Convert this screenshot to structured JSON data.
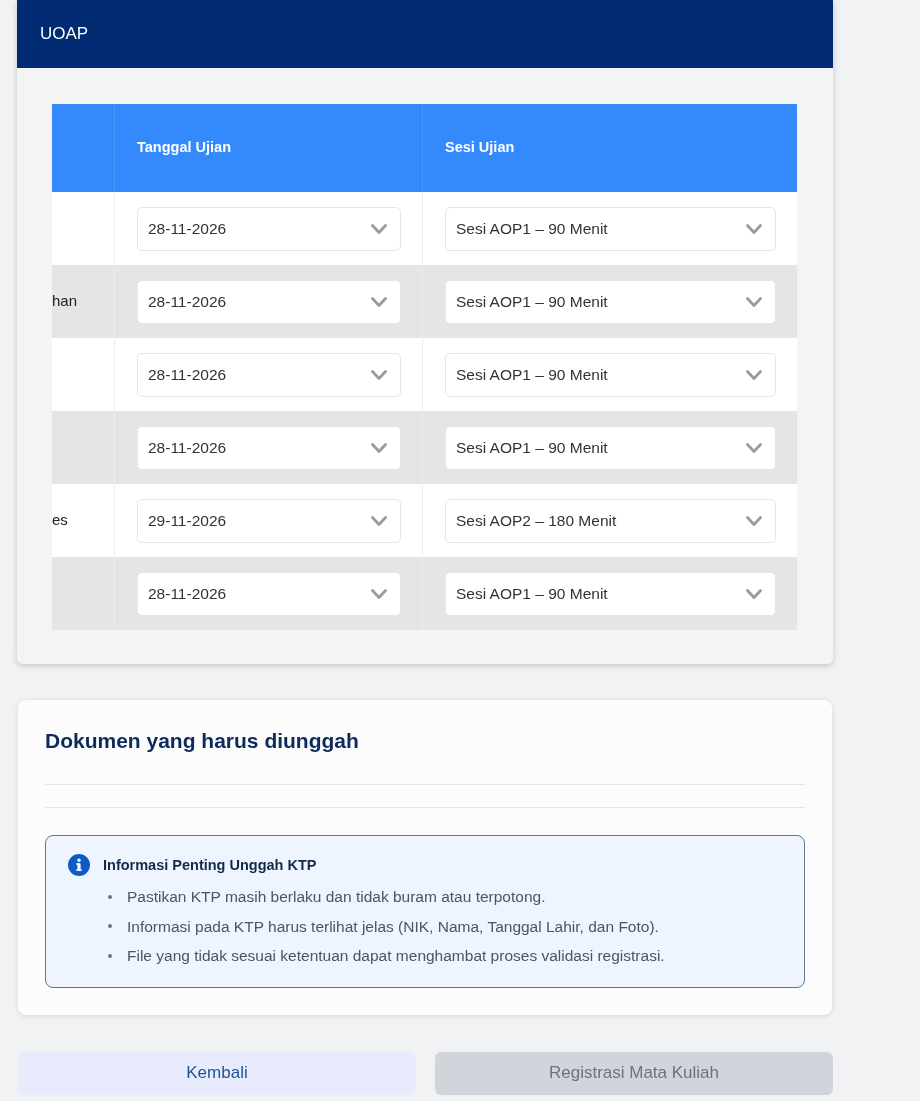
{
  "header": {
    "title": "UOAP"
  },
  "table": {
    "columns": [
      "Tanggal Ujian",
      "Sesi Ujian"
    ],
    "rows": [
      {
        "exam_date": "28-11-2026",
        "exam_session": "Sesi AOP1 – 90 Menit"
      },
      {
        "column_1": "han",
        "exam_date": "28-11-2026",
        "exam_session": "Sesi AOP1 – 90 Menit"
      },
      {
        "exam_date": "28-11-2026",
        "exam_session": "Sesi AOP1 – 90 Menit"
      },
      {
        "exam_date": "28-11-2026",
        "exam_session": "Sesi AOP1 – 90 Menit"
      },
      {
        "column_1": "es",
        "exam_date": "29-11-2026",
        "exam_session": "Sesi AOP2 – 180 Menit"
      },
      {
        "exam_date": "28-11-2026",
        "exam_session": "Sesi AOP1 – 90 Menit"
      }
    ]
  },
  "documents": {
    "title": "Dokumen yang harus diunggah",
    "info": {
      "title": "Informasi Penting Unggah KTP",
      "items": [
        "Pastikan KTP masih berlaku dan tidak buram atau terpotong.",
        "Informasi pada KTP harus terlihat jelas (NIK, Nama, Tanggal Lahir, dan Foto).",
        "File yang tidak sesuai ketentuan dapat menghambat proses validasi registrasi."
      ]
    }
  },
  "buttons": [
    {
      "label": "Kembali",
      "disabled": false
    },
    {
      "label": "Registrasi Mata Kuliah",
      "disabled": true
    }
  ]
}
